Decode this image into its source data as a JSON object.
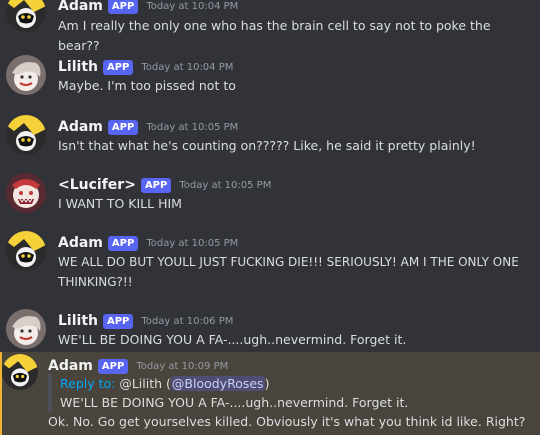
{
  "colors": {
    "background": "#313338",
    "highlight": "#49443c",
    "app_tag": "#5865f2",
    "link": "#00a8fc"
  },
  "messages": [
    {
      "author": "Adam",
      "tag": "APP",
      "time": "Today at 10:04 PM",
      "text": "Am I really the only one who has the brain cell to say not to poke the bear??",
      "avatar_icon": "adam-avatar-icon"
    },
    {
      "author": "Lilith",
      "tag": "APP",
      "time": "Today at 10:04 PM",
      "text": "Maybe. I'm too pissed not to",
      "avatar_icon": "lilith-avatar-icon"
    },
    {
      "author": "Adam",
      "tag": "APP",
      "time": "Today at 10:05 PM",
      "text": "Isn't that what he's counting on????? Like, he said it pretty plainly!",
      "avatar_icon": "adam-avatar-icon"
    },
    {
      "author": "<Lucifer>",
      "tag": "APP",
      "time": "Today at 10:05 PM",
      "text": "I WANT TO KILL HIM",
      "avatar_icon": "lucifer-avatar-icon"
    },
    {
      "author": "Adam",
      "tag": "APP",
      "time": "Today at 10:05 PM",
      "text_line1": "WE ALL DO BUT YOULL JUST FUCKING DIE!!! SERIOUSLY! AM I THE ONLY ONE",
      "text_line2": "THINKING?!!",
      "avatar_icon": "adam-avatar-icon"
    },
    {
      "author": "Lilith",
      "tag": "APP",
      "time": "Today at 10:06 PM",
      "text": "WE'LL BE DOING YOU A FA-....ugh..nevermind. Forget it.",
      "avatar_icon": "lilith-avatar-icon"
    },
    {
      "author": "Adam",
      "tag": "APP",
      "time": "Today at 10:09 PM",
      "reply_prefix": "Reply to:",
      "reply_target": "@Lilith (",
      "reply_mention": "@BloodyRoses",
      "reply_close": ")",
      "reply_quote": "WE'LL BE DOING YOU A FA-....ugh..nevermind. Forget it.",
      "text": "Ok. No. Go get yourselves killed. Obviously it's what you think id like. Right?",
      "avatar_icon": "adam-avatar-icon"
    }
  ]
}
